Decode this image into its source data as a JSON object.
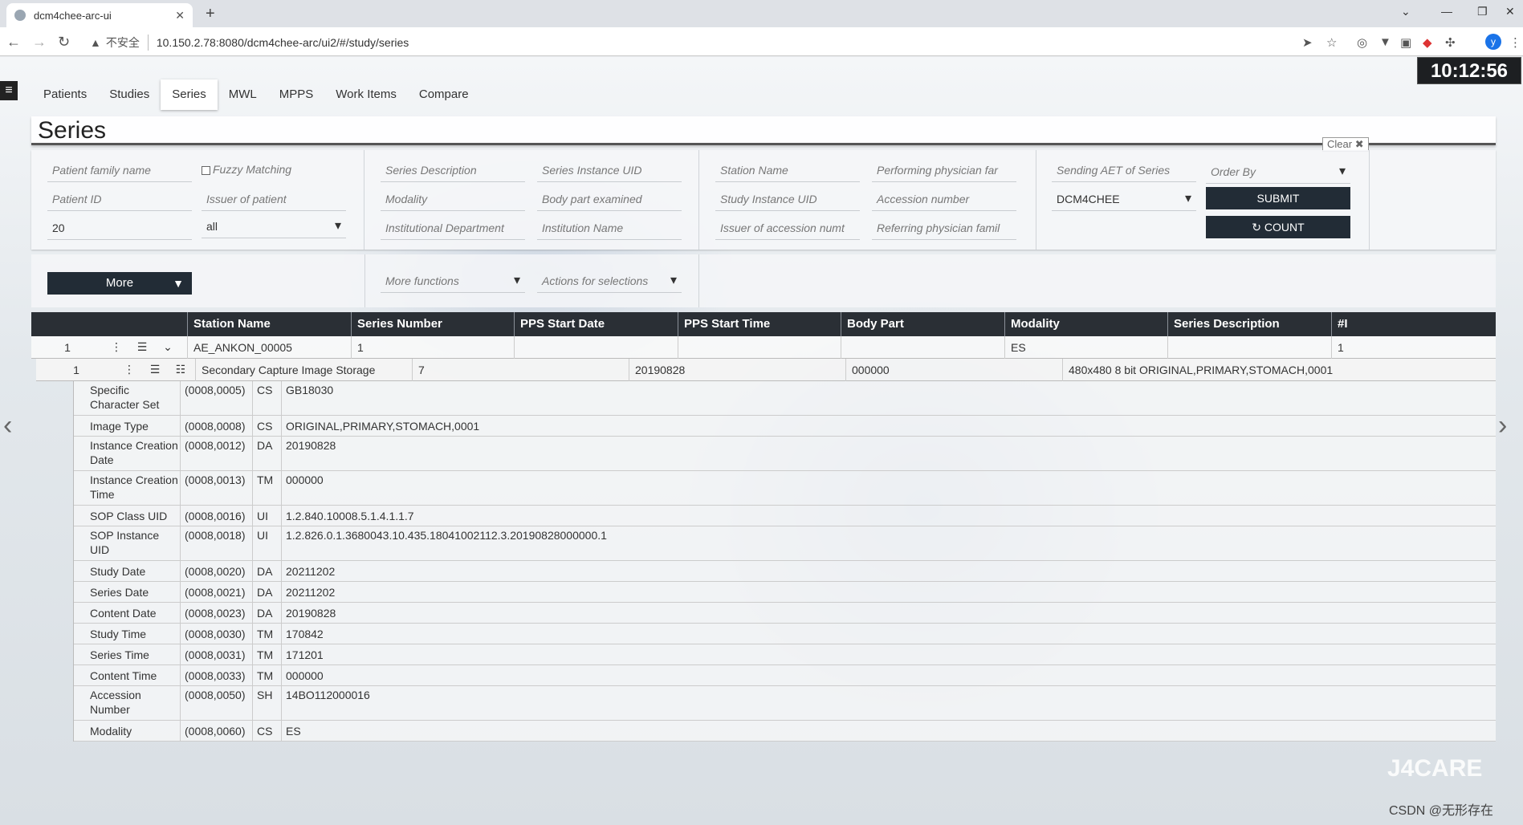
{
  "browser": {
    "tab_title": "dcm4chee-arc-ui",
    "new_tab": "+",
    "insecure_label": "不安全",
    "url": "10.150.2.78:8080/dcm4chee-arc/ui2/#/study/series",
    "profile_initial": "y"
  },
  "clock": "10:12:56",
  "nav": {
    "tabs": [
      "Patients",
      "Studies",
      "Series",
      "MWL",
      "MPPS",
      "Work Items",
      "Compare"
    ],
    "active": "Series"
  },
  "panel": {
    "title": "Series",
    "clear_label": "Clear"
  },
  "filters": {
    "patient_family_name": "Patient family name",
    "fuzzy_matching": "Fuzzy Matching",
    "patient_id": "Patient ID",
    "issuer_of_patient": "Issuer of patient",
    "limit_value": "20",
    "issuer_select_value": "all",
    "series_description": "Series Description",
    "series_instance_uid": "Series Instance UID",
    "modality": "Modality",
    "body_part_examined": "Body part examined",
    "institutional_department": "Institutional Department",
    "institution_name": "Institution Name",
    "station_name": "Station Name",
    "performing_physician": "Performing physician far",
    "study_instance_uid": "Study Instance UID",
    "accession_number": "Accession number",
    "issuer_of_accession": "Issuer of accession numt",
    "referring_physician": "Referring physician famil",
    "sending_aet": "Sending AET of Series",
    "order_by": "Order By",
    "aet_value": "DCM4CHEE",
    "submit_label": "SUBMIT",
    "count_label": "COUNT"
  },
  "actions": {
    "more_label": "More",
    "more_functions": "More functions",
    "actions_for_selections": "Actions for selections"
  },
  "table": {
    "headers": [
      "Station Name",
      "Series Number",
      "PPS Start Date",
      "PPS Start Time",
      "Body Part",
      "Modality",
      "Series Description",
      "#I"
    ],
    "series_row": {
      "index": "1",
      "station_name": "AE_ANKON_00005",
      "series_number": "1",
      "pps_start_date": "",
      "pps_start_time": "",
      "body_part": "",
      "modality": "ES",
      "series_description": "",
      "instances": "1"
    },
    "instance_row": {
      "index": "1",
      "sop_class": "Secondary Capture Image Storage",
      "instance_number": "7",
      "content_date": "20190828",
      "content_time": "000000",
      "image_type": "480x480 8 bit ORIGINAL,PRIMARY,STOMACH,0001"
    }
  },
  "attributes": [
    {
      "name": "Specific Character Set",
      "tag": "(0008,0005)",
      "vr": "CS",
      "value": "GB18030",
      "tall": true
    },
    {
      "name": "Image Type",
      "tag": "(0008,0008)",
      "vr": "CS",
      "value": "ORIGINAL,PRIMARY,STOMACH,0001",
      "tall": false
    },
    {
      "name": "Instance Creation Date",
      "tag": "(0008,0012)",
      "vr": "DA",
      "value": "20190828",
      "tall": true
    },
    {
      "name": "Instance Creation Time",
      "tag": "(0008,0013)",
      "vr": "TM",
      "value": "000000",
      "tall": true
    },
    {
      "name": "SOP Class UID",
      "tag": "(0008,0016)",
      "vr": "UI",
      "value": "1.2.840.10008.5.1.4.1.1.7",
      "tall": false
    },
    {
      "name": "SOP Instance UID",
      "tag": "(0008,0018)",
      "vr": "UI",
      "value": "1.2.826.0.1.3680043.10.435.18041002112.3.20190828000000.1",
      "tall": true
    },
    {
      "name": "Study Date",
      "tag": "(0008,0020)",
      "vr": "DA",
      "value": "20211202",
      "tall": false
    },
    {
      "name": "Series Date",
      "tag": "(0008,0021)",
      "vr": "DA",
      "value": "20211202",
      "tall": false
    },
    {
      "name": "Content Date",
      "tag": "(0008,0023)",
      "vr": "DA",
      "value": "20190828",
      "tall": false
    },
    {
      "name": "Study Time",
      "tag": "(0008,0030)",
      "vr": "TM",
      "value": "170842",
      "tall": false
    },
    {
      "name": "Series Time",
      "tag": "(0008,0031)",
      "vr": "TM",
      "value": "171201",
      "tall": false
    },
    {
      "name": "Content Time",
      "tag": "(0008,0033)",
      "vr": "TM",
      "value": "000000",
      "tall": false
    },
    {
      "name": "Accession Number",
      "tag": "(0008,0050)",
      "vr": "SH",
      "value": "14BO112000016",
      "tall": true
    },
    {
      "name": "Modality",
      "tag": "(0008,0060)",
      "vr": "CS",
      "value": "ES",
      "tall": false
    }
  ],
  "watermark": "J4CARE",
  "credit": "CSDN @无形存在",
  "icons": {
    "back": "arrow-left-icon",
    "forward": "arrow-right-icon",
    "reload": "reload-icon",
    "warning": "warning-icon",
    "menu": "hamburger-icon",
    "prev": "chevron-left-icon",
    "next": "chevron-right-icon"
  }
}
